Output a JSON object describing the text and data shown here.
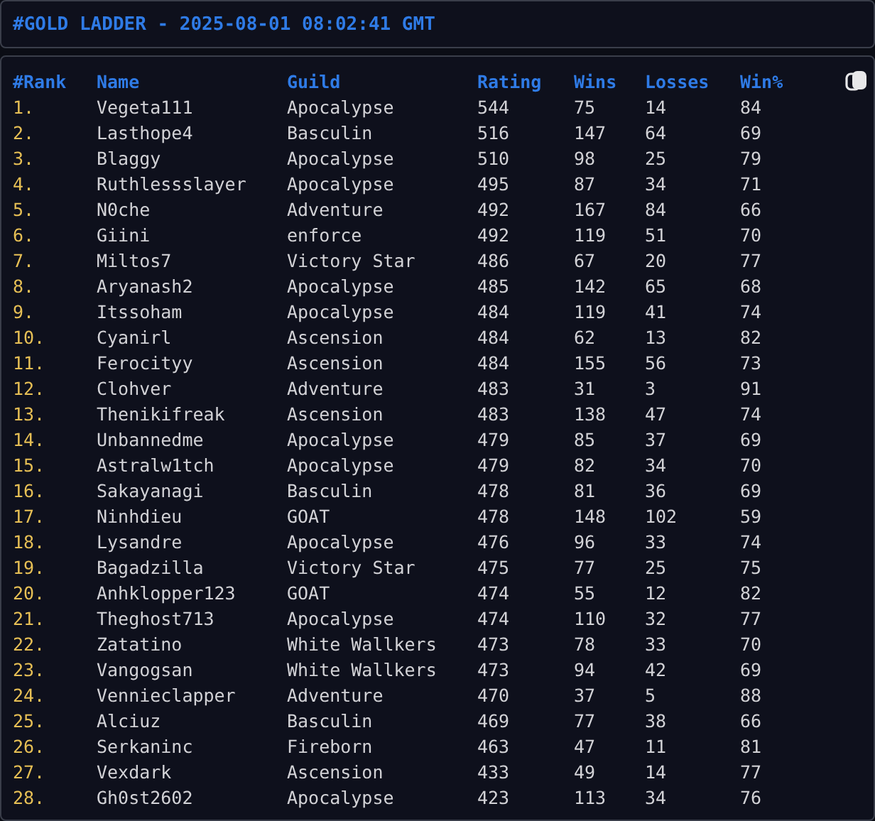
{
  "title": "#GOLD LADDER - 2025-08-01 08:02:41 GMT",
  "table": {
    "columns": [
      "#Rank",
      "Name",
      "Guild",
      "Rating",
      "Wins",
      "Losses",
      "Win%"
    ],
    "rows": [
      {
        "rank": "1.",
        "name": "Vegeta111",
        "guild": "Apocalypse",
        "rating": "544",
        "wins": "75",
        "losses": "14",
        "win_pct": "84"
      },
      {
        "rank": "2.",
        "name": "Lasthope4",
        "guild": "Basculin",
        "rating": "516",
        "wins": "147",
        "losses": "64",
        "win_pct": "69"
      },
      {
        "rank": "3.",
        "name": "Blaggy",
        "guild": "Apocalypse",
        "rating": "510",
        "wins": "98",
        "losses": "25",
        "win_pct": "79"
      },
      {
        "rank": "4.",
        "name": "Ruthlessslayer",
        "guild": "Apocalypse",
        "rating": "495",
        "wins": "87",
        "losses": "34",
        "win_pct": "71"
      },
      {
        "rank": "5.",
        "name": "N0che",
        "guild": "Adventure",
        "rating": "492",
        "wins": "167",
        "losses": "84",
        "win_pct": "66"
      },
      {
        "rank": "6.",
        "name": "Giini",
        "guild": "enforce",
        "rating": "492",
        "wins": "119",
        "losses": "51",
        "win_pct": "70"
      },
      {
        "rank": "7.",
        "name": "Miltos7",
        "guild": "Victory Star",
        "rating": "486",
        "wins": "67",
        "losses": "20",
        "win_pct": "77"
      },
      {
        "rank": "8.",
        "name": "Aryanash2",
        "guild": "Apocalypse",
        "rating": "485",
        "wins": "142",
        "losses": "65",
        "win_pct": "68"
      },
      {
        "rank": "9.",
        "name": "Itssoham",
        "guild": "Apocalypse",
        "rating": "484",
        "wins": "119",
        "losses": "41",
        "win_pct": "74"
      },
      {
        "rank": "10.",
        "name": "Cyanirl",
        "guild": "Ascension",
        "rating": "484",
        "wins": "62",
        "losses": "13",
        "win_pct": "82"
      },
      {
        "rank": "11.",
        "name": "Ferocityy",
        "guild": "Ascension",
        "rating": "484",
        "wins": "155",
        "losses": "56",
        "win_pct": "73"
      },
      {
        "rank": "12.",
        "name": "Clohver",
        "guild": "Adventure",
        "rating": "483",
        "wins": "31",
        "losses": "3",
        "win_pct": "91"
      },
      {
        "rank": "13.",
        "name": "Thenikifreak",
        "guild": "Ascension",
        "rating": "483",
        "wins": "138",
        "losses": "47",
        "win_pct": "74"
      },
      {
        "rank": "14.",
        "name": "Unbannedme",
        "guild": "Apocalypse",
        "rating": "479",
        "wins": "85",
        "losses": "37",
        "win_pct": "69"
      },
      {
        "rank": "15.",
        "name": "Astralw1tch",
        "guild": "Apocalypse",
        "rating": "479",
        "wins": "82",
        "losses": "34",
        "win_pct": "70"
      },
      {
        "rank": "16.",
        "name": "Sakayanagi",
        "guild": "Basculin",
        "rating": "478",
        "wins": "81",
        "losses": "36",
        "win_pct": "69"
      },
      {
        "rank": "17.",
        "name": "Ninhdieu",
        "guild": "GOAT",
        "rating": "478",
        "wins": "148",
        "losses": "102",
        "win_pct": "59"
      },
      {
        "rank": "18.",
        "name": "Lysandre",
        "guild": "Apocalypse",
        "rating": "476",
        "wins": "96",
        "losses": "33",
        "win_pct": "74"
      },
      {
        "rank": "19.",
        "name": "Bagadzilla",
        "guild": "Victory Star",
        "rating": "475",
        "wins": "77",
        "losses": "25",
        "win_pct": "75"
      },
      {
        "rank": "20.",
        "name": "Anhklopper123",
        "guild": "GOAT",
        "rating": "474",
        "wins": "55",
        "losses": "12",
        "win_pct": "82"
      },
      {
        "rank": "21.",
        "name": "Theghost713",
        "guild": "Apocalypse",
        "rating": "474",
        "wins": "110",
        "losses": "32",
        "win_pct": "77"
      },
      {
        "rank": "22.",
        "name": "Zatatino",
        "guild": "White Wallkers",
        "rating": "473",
        "wins": "78",
        "losses": "33",
        "win_pct": "70"
      },
      {
        "rank": "23.",
        "name": "Vangogsan",
        "guild": "White Wallkers",
        "rating": "473",
        "wins": "94",
        "losses": "42",
        "win_pct": "69"
      },
      {
        "rank": "24.",
        "name": "Vennieclapper",
        "guild": "Adventure",
        "rating": "470",
        "wins": "37",
        "losses": "5",
        "win_pct": "88"
      },
      {
        "rank": "25.",
        "name": "Alciuz",
        "guild": "Basculin",
        "rating": "469",
        "wins": "77",
        "losses": "38",
        "win_pct": "66"
      },
      {
        "rank": "26.",
        "name": "Serkaninc",
        "guild": "Fireborn",
        "rating": "463",
        "wins": "47",
        "losses": "11",
        "win_pct": "81"
      },
      {
        "rank": "27.",
        "name": "Vexdark",
        "guild": "Ascension",
        "rating": "433",
        "wins": "49",
        "losses": "14",
        "win_pct": "77"
      },
      {
        "rank": "28.",
        "name": "Gh0st2602",
        "guild": "Apocalypse",
        "rating": "423",
        "wins": "113",
        "losses": "34",
        "win_pct": "76"
      }
    ]
  }
}
